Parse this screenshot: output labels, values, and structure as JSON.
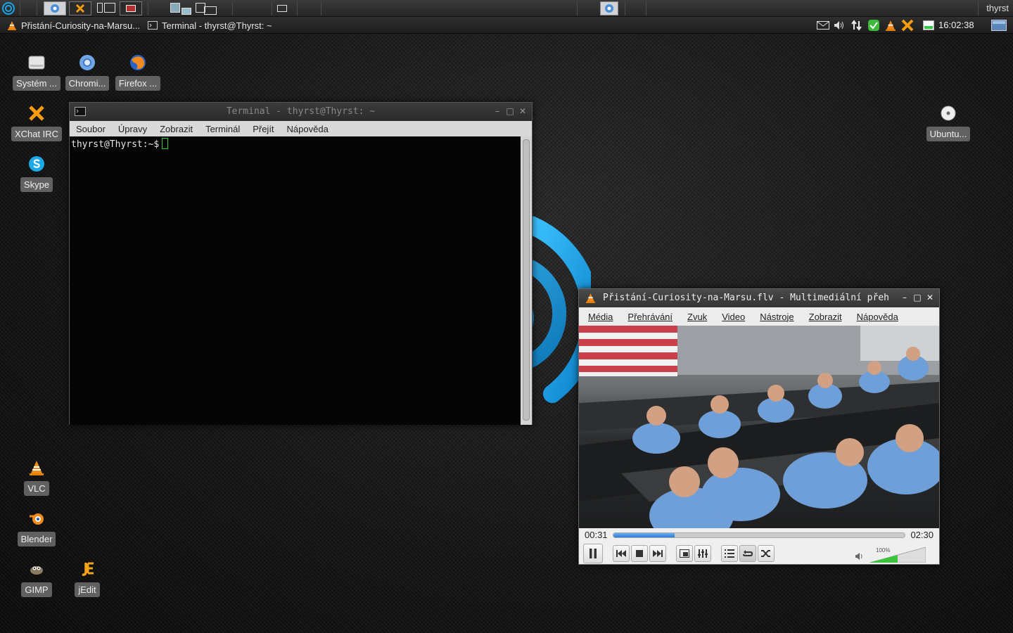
{
  "top_panel": {
    "user": "thyrst"
  },
  "taskbar": {
    "tasks": [
      {
        "label": "Přistání-Curiosity-na-Marsu...",
        "icon": "vlc-cone-icon"
      },
      {
        "label": "Terminal - thyrst@Thyrst: ~",
        "icon": "terminal-icon"
      }
    ],
    "clock": "16:02:38"
  },
  "desktop_icons": [
    {
      "label": "Systém ...",
      "icon": "drive-icon"
    },
    {
      "label": "Chromi...",
      "icon": "chromium-icon"
    },
    {
      "label": "Firefox ...",
      "icon": "firefox-icon"
    },
    {
      "label": "XChat IRC",
      "icon": "xchat-icon"
    },
    {
      "label": "Skype",
      "icon": "skype-icon"
    },
    {
      "label": "Ubuntu...",
      "icon": "disc-icon"
    },
    {
      "label": "VLC",
      "icon": "vlc-cone-icon"
    },
    {
      "label": "Blender",
      "icon": "blender-icon"
    },
    {
      "label": "GIMP",
      "icon": "gimp-icon"
    },
    {
      "label": "jEdit",
      "icon": "jedit-icon"
    }
  ],
  "terminal": {
    "title": "Terminal - thyrst@Thyrst: ~",
    "menu": [
      "Soubor",
      "Úpravy",
      "Zobrazit",
      "Terminál",
      "Přejít",
      "Nápověda"
    ],
    "prompt": "thyrst@Thyrst:~$"
  },
  "vlc": {
    "title": "Přistání-Curiosity-na-Marsu.flv - Multimediální přeh",
    "menu": [
      "Média",
      "Přehrávání",
      "Zvuk",
      "Video",
      "Nástroje",
      "Zobrazit",
      "Nápověda"
    ],
    "time_current": "00:31",
    "time_total": "02:30",
    "progress": 0.21,
    "volume_label": "100%",
    "volume": 0.5
  },
  "colors": {
    "logo_blue": "#1aa3e8",
    "seek_blue": "#2a7ad6",
    "volume_green": "#3cc43c"
  }
}
